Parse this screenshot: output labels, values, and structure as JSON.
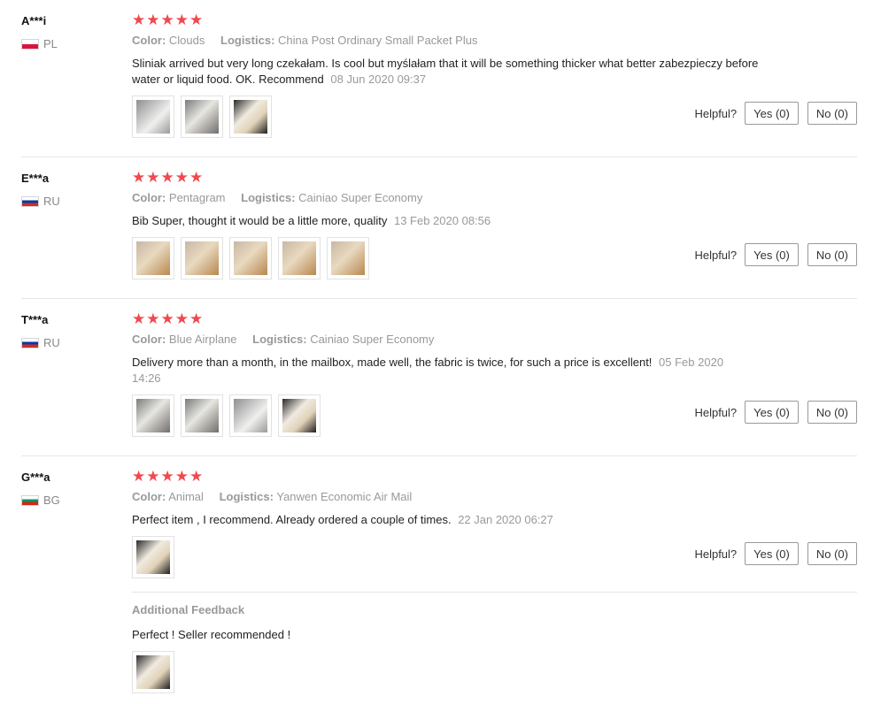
{
  "labels": {
    "color": "Color:",
    "logistics": "Logistics:",
    "helpful": "Helpful?",
    "star": "★"
  },
  "reviews": [
    {
      "user": "A***i",
      "country": "PL",
      "color": "Clouds",
      "logistics": "China Post Ordinary Small Packet Plus",
      "text": "Sliniak arrived but very long czekałam. Is cool but myślałam that it will be something thicker what better zabezpieczy before water or liquid food. OK. Recommend",
      "date": "08 Jun 2020 09:37",
      "photo_count": 3,
      "yes": "Yes (0)",
      "no": "No (0)"
    },
    {
      "user": "E***a",
      "country": "RU",
      "color": "Pentagram",
      "logistics": "Cainiao Super Economy",
      "text": "Bib Super, thought it would be a little more, quality",
      "date": "13 Feb 2020 08:56",
      "photo_count": 5,
      "yes": "Yes (0)",
      "no": "No (0)"
    },
    {
      "user": "T***a",
      "country": "RU",
      "color": "Blue Airplane",
      "logistics": "Cainiao Super Economy",
      "text": "Delivery more than a month, in the mailbox, made well, the fabric is twice, for such a price is excellent!",
      "date": "05 Feb 2020 14:26",
      "photo_count": 4,
      "yes": "Yes (0)",
      "no": "No (0)"
    },
    {
      "user": "G***a",
      "country": "BG",
      "color": "Animal",
      "logistics": "Yanwen Economic Air Mail",
      "text": "Perfect item , I recommend. Already ordered a couple of times.",
      "date": "22 Jan 2020 06:27",
      "photo_count": 1,
      "yes": "Yes (0)",
      "no": "No (0)",
      "additional_title": "Additional Feedback",
      "additional_text": "Perfect ! Seller recommended !",
      "additional_photo_count": 1
    }
  ]
}
